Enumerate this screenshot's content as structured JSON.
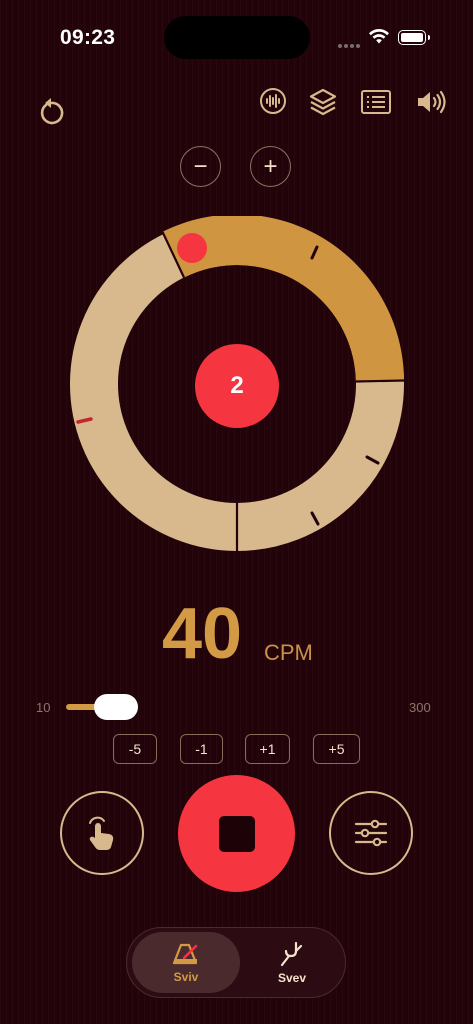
{
  "status": {
    "time": "09:23",
    "icons": [
      "wifi-icon",
      "battery-icon"
    ]
  },
  "toolbar": {
    "left": "reset-icon",
    "right": [
      "waveform-icon",
      "layers-icon",
      "list-icon",
      "volume-icon"
    ]
  },
  "dial": {
    "current_beat": "2",
    "minus": "−",
    "plus": "+"
  },
  "tempo": {
    "value": "40",
    "unit": "CPM",
    "min": "10",
    "max": "300",
    "level": 0.1
  },
  "steps": [
    "-5",
    "-1",
    "+1",
    "+5"
  ],
  "controls": {
    "tap": "tap-hand-icon",
    "stop": "stop-icon",
    "settings": "sliders-icon"
  },
  "tabs": [
    {
      "label": "Sviv",
      "icon": "metronome-icon",
      "active": true
    },
    {
      "label": "Svev",
      "icon": "tuning-fork-icon",
      "active": false
    }
  ],
  "colors": {
    "background": "#220309",
    "accent": "#d39a45",
    "ring_light": "#d8b98e",
    "red": "#f5353f"
  }
}
